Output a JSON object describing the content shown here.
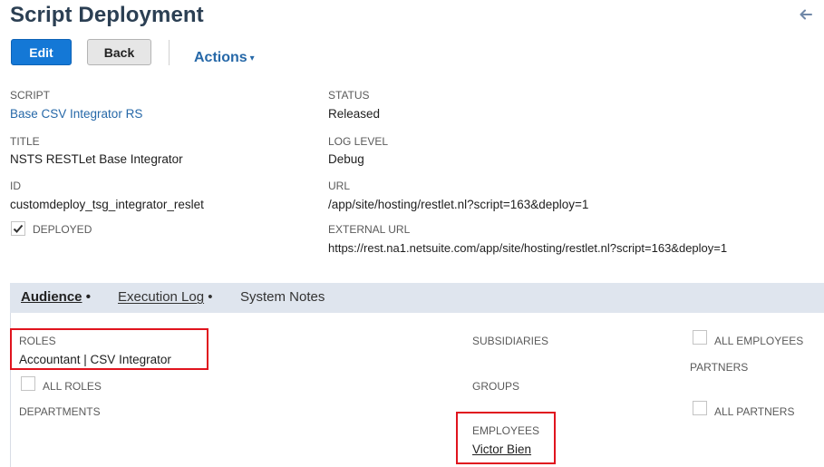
{
  "page": {
    "title": "Script Deployment"
  },
  "toolbar": {
    "edit_label": "Edit",
    "back_label": "Back",
    "actions_label": "Actions",
    "actions_caret": "▾"
  },
  "fields": {
    "script_label": "SCRIPT",
    "script_value": "Base CSV Integrator RS",
    "title_label": "TITLE",
    "title_value": "NSTS RESTLet Base Integrator",
    "id_label": "ID",
    "id_value": "customdeploy_tsg_integrator_reslet",
    "deployed_label": "DEPLOYED",
    "deployed_checked": true,
    "status_label": "STATUS",
    "status_value": "Released",
    "log_level_label": "LOG LEVEL",
    "log_level_value": "Debug",
    "url_label": "URL",
    "url_value": "/app/site/hosting/restlet.nl?script=163&deploy=1",
    "external_url_label": "EXTERNAL URL",
    "external_url_value": "https://rest.na1.netsuite.com/app/site/hosting/restlet.nl?script=163&deploy=1"
  },
  "tabs": [
    {
      "label": "Audience",
      "suffix": "•",
      "active": true
    },
    {
      "label": "Execution Log",
      "suffix": "•",
      "active": false
    },
    {
      "label": "System Notes",
      "suffix": "",
      "active": false
    }
  ],
  "audience": {
    "roles_label": "ROLES",
    "roles_value": "Accountant | CSV Integrator",
    "all_roles_label": "ALL ROLES",
    "all_roles_checked": false,
    "departments_label": "DEPARTMENTS",
    "subsidiaries_label": "SUBSIDIARIES",
    "groups_label": "GROUPS",
    "employees_label": "EMPLOYEES",
    "employees_value": "Victor Bien",
    "all_employees_label": "ALL EMPLOYEES",
    "all_employees_checked": false,
    "partners_label": "PARTNERS",
    "all_partners_label": "ALL PARTNERS",
    "all_partners_checked": false
  },
  "colors": {
    "primary_button": "#1478d6",
    "link": "#2668a8",
    "title": "#2b3f53",
    "highlight": "#e0141e",
    "tab_bar": "#dfe5ee"
  }
}
